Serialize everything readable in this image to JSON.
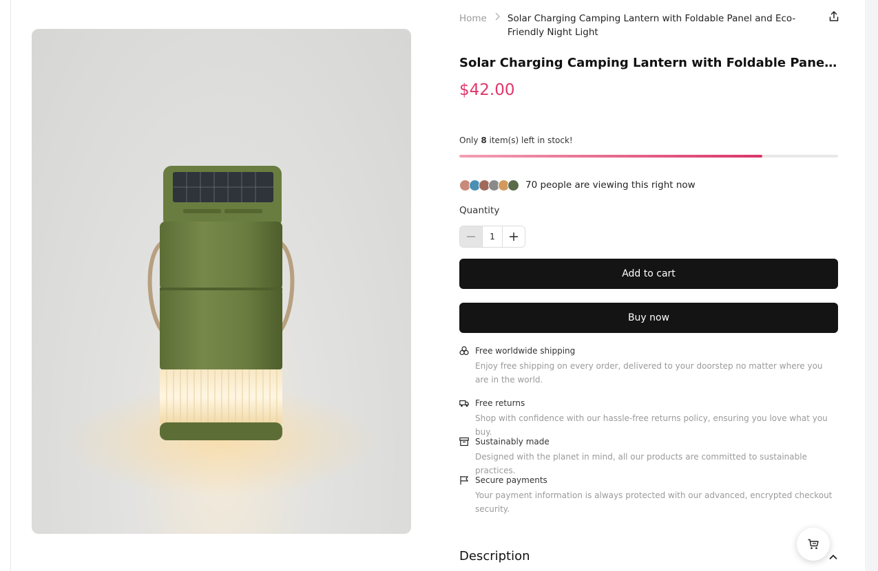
{
  "breadcrumb": {
    "home": "Home",
    "current": "Solar Charging Camping Lantern with Foldable Panel and Eco-Friendly Night Light"
  },
  "product": {
    "title": "Solar Charging Camping Lantern with Foldable Panel and Eco-Friendly Night Light",
    "price": "$42.00",
    "image_alt": "Green solar camping lantern with rope handle and glowing base"
  },
  "stock": {
    "prefix": "Only",
    "count": "8",
    "suffix": "item(s) left in stock!",
    "level_fraction": 0.8
  },
  "viewers": {
    "text": "70 people are viewing this right now",
    "avatar_colors": [
      "#c98a7a",
      "#4b8fb4",
      "#a06a5a",
      "#8a8a8a",
      "#d29a5e",
      "#5a6b4a"
    ]
  },
  "quantity": {
    "label": "Quantity",
    "value": "1"
  },
  "actions": {
    "add_to_cart": "Add to cart",
    "buy_now": "Buy now"
  },
  "features": [
    {
      "icon": "shapes-icon",
      "title": "Free worldwide shipping",
      "description": "Enjoy free shipping on every order, delivered to your doorstep no matter where you are in the world."
    },
    {
      "icon": "truck-icon",
      "title": "Free returns",
      "description": "Shop with confidence with our hassle-free returns policy, ensuring you love what you buy."
    },
    {
      "icon": "archive-box-icon",
      "title": "Sustainably made",
      "description": "Designed with the planet in mind, all our products are committed to sustainable practices."
    },
    {
      "icon": "flag-icon",
      "title": "Secure payments",
      "description": "Your payment information is always protected with our advanced, encrypted checkout security."
    }
  ],
  "description": {
    "heading": "Description"
  },
  "colors": {
    "price": "#e0376a",
    "button": "#141414",
    "stock_bar": "#d9366a"
  }
}
